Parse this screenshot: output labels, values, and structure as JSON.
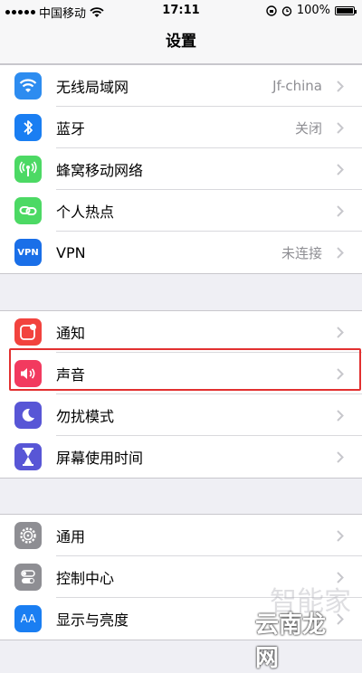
{
  "status_bar": {
    "carrier": "中国移动",
    "time": "17:11",
    "battery": "100%",
    "battery_level": 1.0
  },
  "nav": {
    "title": "设置"
  },
  "groups": [
    {
      "rows": [
        {
          "label": "无线局域网",
          "value": "Jf-china",
          "icon": "wifi-icon",
          "color": "#2d8cf0"
        },
        {
          "label": "蓝牙",
          "value": "关闭",
          "icon": "bluetooth-icon",
          "color": "#1a7ef2"
        },
        {
          "label": "蜂窝移动网络",
          "value": "",
          "icon": "cellular-icon",
          "color": "#4cd964"
        },
        {
          "label": "个人热点",
          "value": "",
          "icon": "hotspot-icon",
          "color": "#4cd964"
        },
        {
          "label": "VPN",
          "value": "未连接",
          "icon": "vpn-icon",
          "icon_text": "VPN",
          "color": "#1a6fe8"
        }
      ]
    },
    {
      "rows": [
        {
          "label": "通知",
          "value": "",
          "icon": "notifications-icon",
          "color": "#f2433e"
        },
        {
          "label": "声音",
          "value": "",
          "icon": "sound-icon",
          "color": "#f23a5f"
        },
        {
          "label": "勿扰模式",
          "value": "",
          "icon": "moon-icon",
          "color": "#5856d6"
        },
        {
          "label": "屏幕使用时间",
          "value": "",
          "icon": "hourglass-icon",
          "color": "#5856d6"
        }
      ]
    },
    {
      "rows": [
        {
          "label": "通用",
          "value": "",
          "icon": "gear-icon",
          "color": "#8e8e93"
        },
        {
          "label": "控制中心",
          "value": "",
          "icon": "control-center-icon",
          "color": "#8e8e93"
        },
        {
          "label": "显示与亮度",
          "value": "",
          "icon": "display-icon",
          "icon_text": "AA",
          "color": "#1a7ef2"
        }
      ]
    }
  ],
  "watermark": {
    "line1": "智能家",
    "line2": "云南龙网"
  }
}
